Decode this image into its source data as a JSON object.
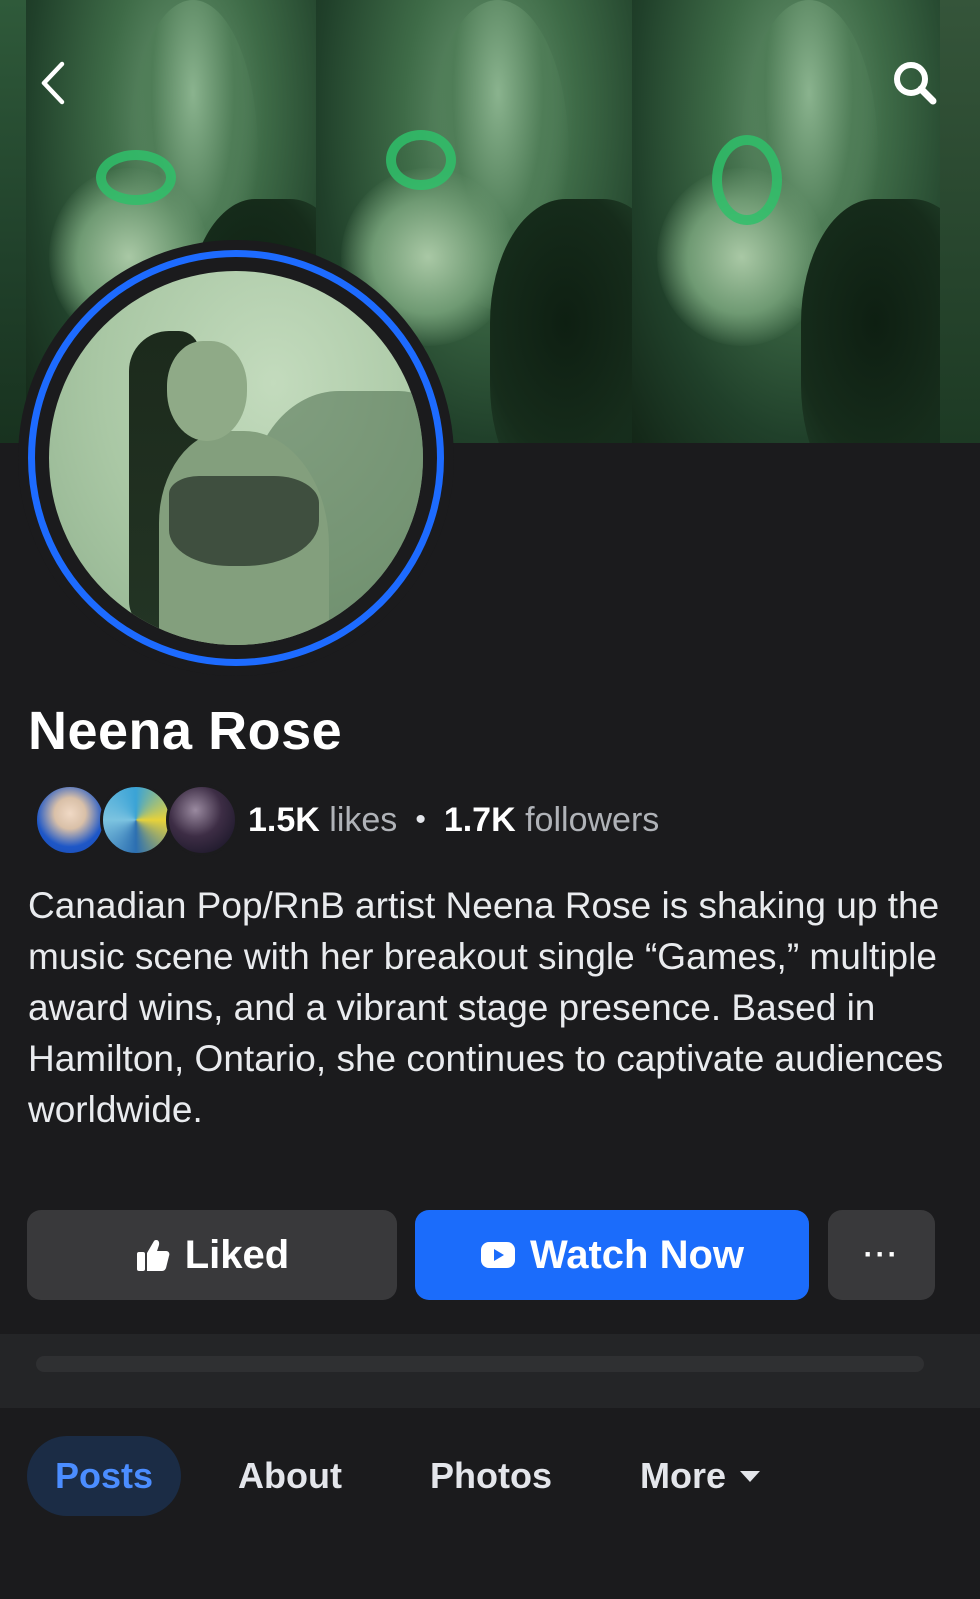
{
  "cover": {
    "back_icon": "chevron-left-icon",
    "search_icon": "search-icon"
  },
  "profile": {
    "name": "Neena Rose",
    "likes_count": "1.5K",
    "likes_label": "likes",
    "separator": "•",
    "followers_count": "1.7K",
    "followers_label": "followers",
    "bio": "Canadian Pop/RnB artist Neena Rose is shaking up the music scene with her breakout single “Games,” multiple award wins, and a vibrant stage presence. Based in Hamilton, Ontario, she continues to captivate audiences worldwide."
  },
  "actions": {
    "liked_label": "Liked",
    "watch_label": "Watch Now",
    "more_label": "···"
  },
  "tabs": [
    {
      "label": "Posts",
      "active": true
    },
    {
      "label": "About",
      "active": false
    },
    {
      "label": "Photos",
      "active": false
    },
    {
      "label": "More",
      "active": false
    }
  ],
  "colors": {
    "accent": "#1b6cfb",
    "ring": "#1d6bff",
    "active_tab_text": "#4b8dff",
    "background": "#1b1b1d"
  }
}
